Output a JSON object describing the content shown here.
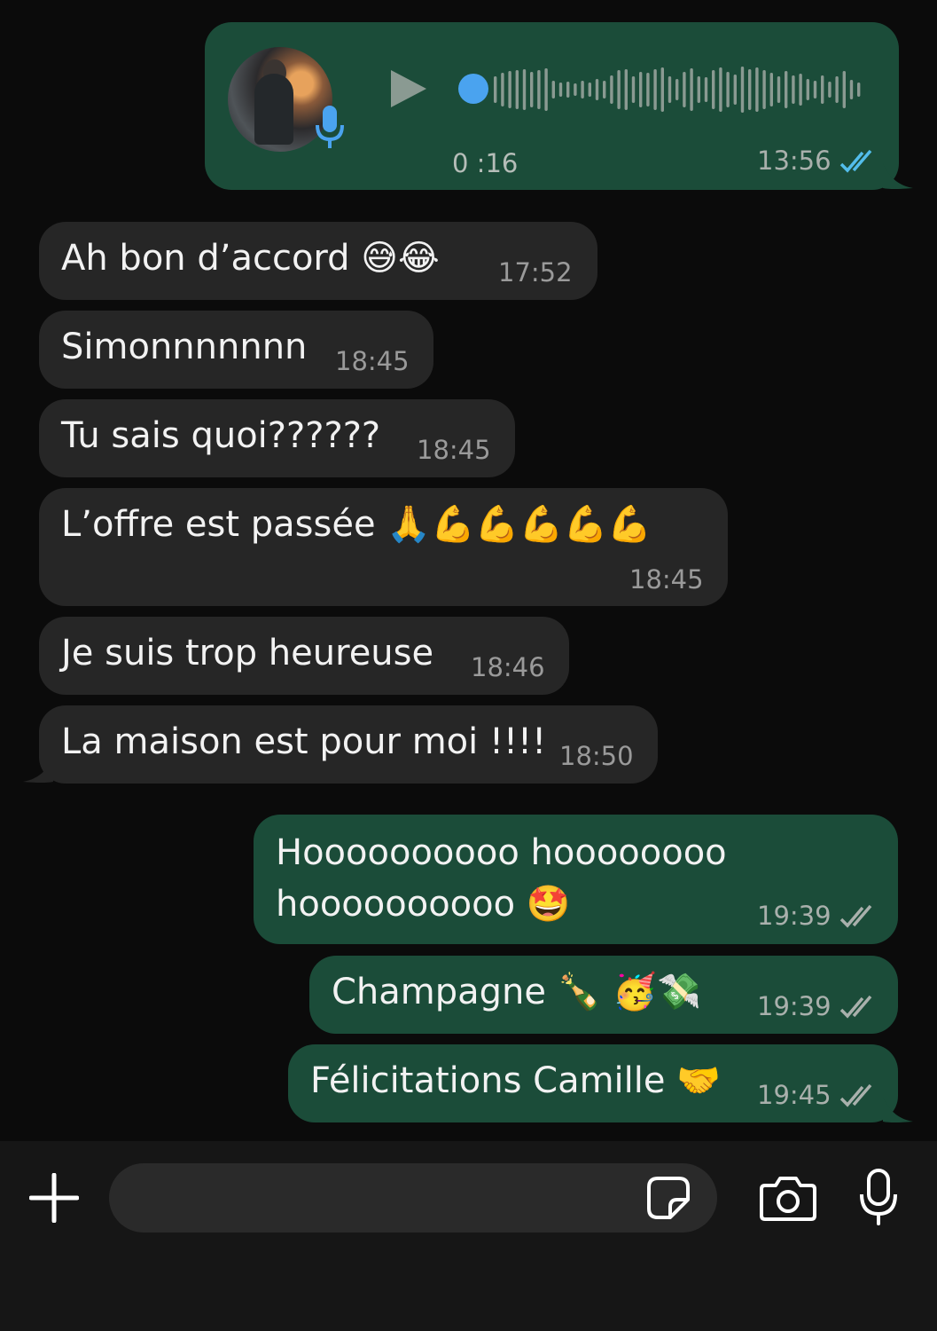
{
  "voice_message": {
    "duration": "0 :16",
    "time": "13:56",
    "status": "read",
    "avatar_icon": "avatar-photo",
    "play_icon": "play-icon",
    "mic_icon": "mic-icon"
  },
  "messages": [
    {
      "text": "Ah bon d’accord 😅😂",
      "time": "17:52"
    },
    {
      "text": "Simonnnnnnn",
      "time": "18:45"
    },
    {
      "text": "Tu sais quoi??????",
      "time": "18:45"
    },
    {
      "text": "L’offre est passée 🙏💪💪💪💪💪",
      "time": "18:45"
    },
    {
      "text": "Je suis trop heureuse",
      "time": "18:46"
    },
    {
      "text": "La maison est pour moi !!!!",
      "time": "18:50"
    },
    {
      "line1": "Hoooooooooo hoooooooo",
      "line2": "hoooooooooo 🤩",
      "time": "19:39",
      "status": "delivered"
    },
    {
      "text": "Champagne 🍾 🥳💸",
      "time": "19:39",
      "status": "delivered"
    },
    {
      "text": "Félicitations Camille 🤝",
      "time": "19:45",
      "status": "delivered"
    }
  ],
  "composer": {
    "plus_icon": "plus-icon",
    "sticker_icon": "sticker-icon",
    "camera_icon": "camera-icon",
    "mic_icon": "mic-icon"
  },
  "colors": {
    "background": "#0b0b0b",
    "incoming_bubble": "#262626",
    "outgoing_bubble": "#1b4c39",
    "read_ticks": "#53bdeb",
    "delivered_ticks": "#a9b0ac"
  }
}
